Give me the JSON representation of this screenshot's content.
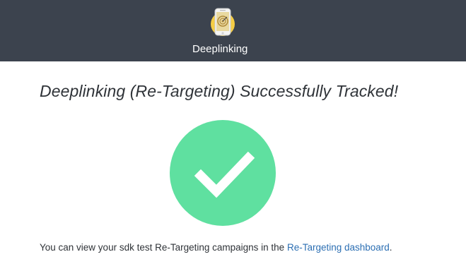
{
  "header": {
    "icon": "deeplink-phone-target-icon",
    "title": "Deeplinking"
  },
  "main": {
    "title": "Deeplinking (Re-Targeting) Successfully Tracked!",
    "status_icon": "checkmark-icon",
    "message_prefix": "You can view your sdk test Re-Targeting campaigns in the ",
    "link_text": "Re-Targeting dashboard",
    "message_suffix": "."
  },
  "colors": {
    "header_background": "#3c434e",
    "success_green": "#5fe0a0",
    "link_blue": "#2c6fb3",
    "icon_yellow": "#f5cd45"
  }
}
